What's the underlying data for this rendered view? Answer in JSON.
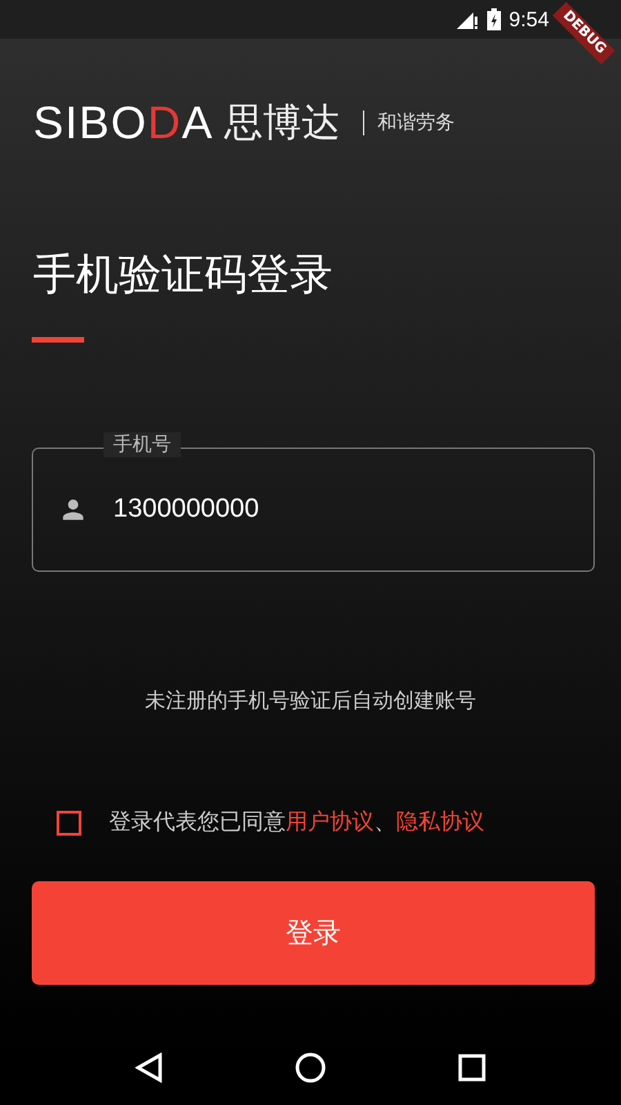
{
  "status_bar": {
    "time": "9:54",
    "debug_banner": "DEBUG"
  },
  "logo": {
    "wordmark_start": "SIBO",
    "wordmark_accent": "D",
    "wordmark_end": "A",
    "chinese_name": "思博达",
    "slogan": "和谐劳务"
  },
  "title": "手机验证码登录",
  "phone_field": {
    "label": "手机号",
    "value": "1300000000"
  },
  "hint": "未注册的手机号验证后自动创建账号",
  "agreement": {
    "checked": false,
    "text": "登录代表您已同意",
    "links": [
      {
        "label": "用户协议"
      },
      {
        "label": "隐私协议"
      }
    ],
    "separator": "、"
  },
  "login_button": "登录"
}
